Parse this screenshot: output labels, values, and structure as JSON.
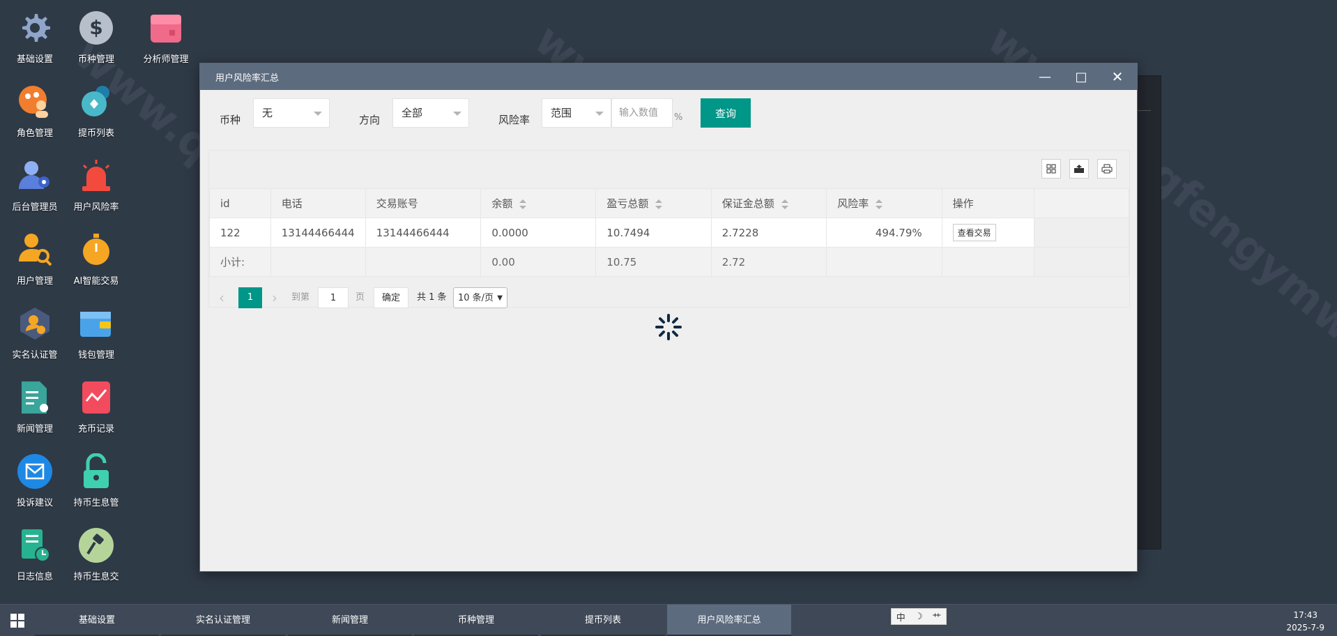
{
  "desktop": {
    "icons": [
      {
        "label": "基础设置",
        "icon": "gear-icon"
      },
      {
        "label": "币种管理",
        "icon": "dollar-icon"
      },
      {
        "label": "分析师管理",
        "icon": "store-icon"
      },
      {
        "label": "角色管理",
        "icon": "role-icon"
      },
      {
        "label": "提币列表",
        "icon": "withdraw-icon"
      },
      {
        "label": "后台管理员",
        "icon": "admin-icon"
      },
      {
        "label": "用户风险率",
        "icon": "alarm-icon"
      },
      {
        "label": "用户管理",
        "icon": "user-search-icon"
      },
      {
        "label": "AI智能交易",
        "icon": "stopwatch-icon"
      },
      {
        "label": "实名认证管",
        "icon": "verify-icon"
      },
      {
        "label": "钱包管理",
        "icon": "wallet-icon"
      },
      {
        "label": "新闻管理",
        "icon": "news-icon"
      },
      {
        "label": "充币记录",
        "icon": "chart-icon"
      },
      {
        "label": "投诉建议",
        "icon": "mail-icon"
      },
      {
        "label": "持币生息管",
        "icon": "lock-icon"
      },
      {
        "label": "日志信息",
        "icon": "log-icon"
      },
      {
        "label": "持币生息交",
        "icon": "hammer-icon"
      }
    ]
  },
  "dialog": {
    "title": "用户风险率汇总",
    "filters": {
      "currency_label": "币种",
      "currency_value": "无",
      "direction_label": "方向",
      "direction_value": "全部",
      "risk_label": "风险率",
      "risk_mode_value": "范围",
      "risk_input_placeholder": "输入数值",
      "risk_unit": "%",
      "query_button": "查询"
    },
    "table": {
      "columns": [
        "id",
        "电话",
        "交易账号",
        "余额",
        "盈亏总额",
        "保证金总额",
        "风险率",
        "操作"
      ],
      "rows": [
        {
          "id": "122",
          "phone": "13144466444",
          "account": "13144466444",
          "balance": "0.0000",
          "pnl": "10.7494",
          "margin": "2.7228",
          "risk": "494.79%",
          "action": "查看交易"
        }
      ],
      "total": {
        "label": "小计:",
        "balance": "0.00",
        "pnl": "10.75",
        "margin": "2.72"
      }
    },
    "pager": {
      "prev": "‹",
      "current": "1",
      "next": "›",
      "goto_label": "到第",
      "goto_value": "1",
      "page_unit": "页",
      "confirm": "确定",
      "total_text": "共 1 条",
      "page_size": "10 条/页"
    }
  },
  "taskbar": {
    "tasks": [
      "基础设置",
      "实名认证管理",
      "新闻管理",
      "币种管理",
      "提币列表",
      "用户风险率汇总"
    ],
    "active_index": 5,
    "ime": [
      "中",
      "☽",
      "⺾"
    ],
    "time": "17:43",
    "date": "2025-7-9"
  },
  "colors": {
    "accent": "#009688",
    "titlebar": "#5d6b7f",
    "desktop": "#2f3a47"
  }
}
